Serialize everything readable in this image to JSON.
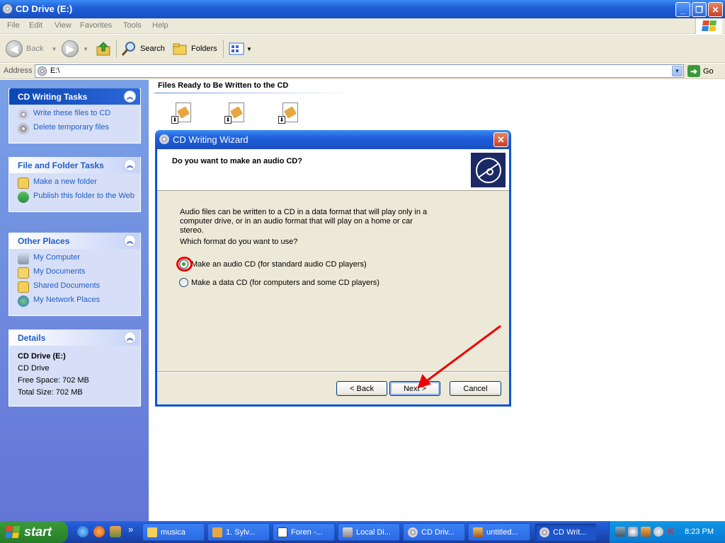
{
  "window": {
    "title": "CD Drive (E:)",
    "controls": {
      "minimize": "_",
      "restore": "❐",
      "close": "✕"
    }
  },
  "menu": [
    "File",
    "Edit",
    "View",
    "Favorites",
    "Tools",
    "Help"
  ],
  "toolbar": {
    "back_label": "Back",
    "search_label": "Search",
    "folders_label": "Folders"
  },
  "address": {
    "label": "Address",
    "value": "E:\\",
    "go_label": "Go"
  },
  "tasks_pane": {
    "cd_tasks": {
      "title": "CD Writing Tasks",
      "items": [
        "Write these files to CD",
        "Delete temporary files"
      ]
    },
    "file_tasks": {
      "title": "File and Folder Tasks",
      "items": [
        "Make a new folder",
        "Publish this folder to the Web"
      ]
    },
    "other_places": {
      "title": "Other Places",
      "items": [
        "My Computer",
        "My Documents",
        "Shared Documents",
        "My Network Places"
      ]
    },
    "details": {
      "title": "Details",
      "name": "CD Drive (E:)",
      "type": "CD Drive",
      "free_space": "Free Space: 702 MB",
      "total_size": "Total Size: 702 MB"
    }
  },
  "content": {
    "section_title": "Files Ready to Be Written to the CD"
  },
  "wizard": {
    "title": "CD Writing Wizard",
    "question": "Do you want to make an audio CD?",
    "description": "Audio files can be written to a CD in a data format that will play only in a computer drive, or in an audio format that will play on a home or car stereo.",
    "prompt": "Which format do you want to use?",
    "options": [
      {
        "label": "Make an audio CD (for standard audio CD players)",
        "selected": true
      },
      {
        "label": "Make a data CD (for computers and some CD players)",
        "selected": false
      }
    ],
    "buttons": {
      "back": "< Back",
      "next": "Next >",
      "cancel": "Cancel"
    }
  },
  "taskbar": {
    "start_label": "start",
    "more": "»",
    "tasks": [
      "musica",
      "1. Sylv...",
      "Foren -...",
      "Local Di...",
      "CD Driv...",
      "untitled...",
      "CD Writ..."
    ],
    "active_task_index": 6,
    "clock": "8:23 PM"
  }
}
